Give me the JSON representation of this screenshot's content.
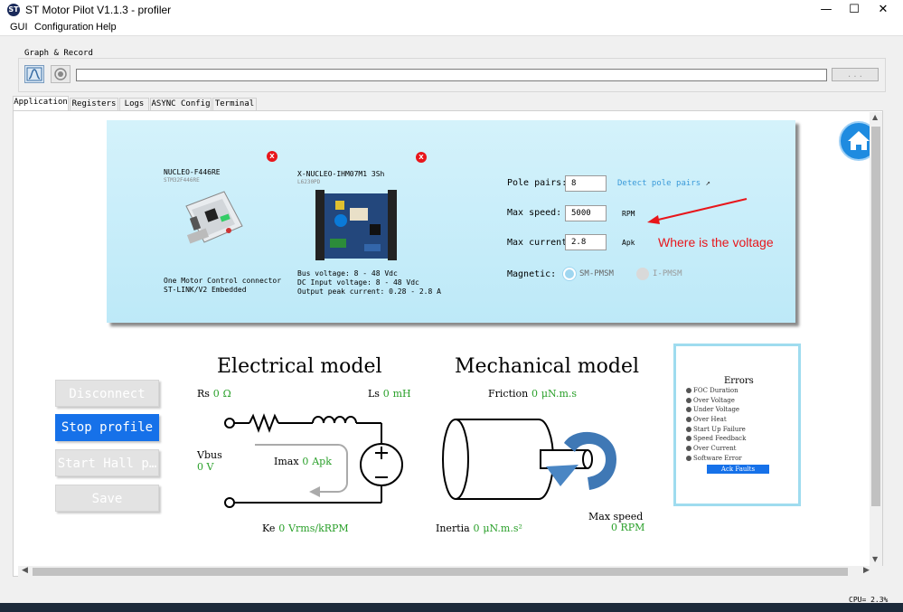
{
  "window": {
    "title": "ST Motor Pilot V1.1.3 - profiler",
    "minimize": "—",
    "maximize": "☐",
    "close": "✕"
  },
  "menu": [
    "GUI",
    "Configuration",
    "Help"
  ],
  "graph_record": {
    "label": "Graph & Record",
    "path_value": "",
    "browse_label": ". . ."
  },
  "tabs": [
    "Application",
    "Registers",
    "Logs",
    "ASYNC Config",
    "Terminal"
  ],
  "boards": {
    "control": {
      "name": "NUCLEO-F446RE",
      "sub": "STM32F446RE",
      "desc": "One Motor Control connector\nST-LINK/V2 Embedded"
    },
    "power": {
      "name": "X-NUCLEO-IHM07M1 3Sh",
      "sub": "L6230PD",
      "desc": "Bus voltage: 8 - 48 Vdc\nDC Input voltage: 8 - 48 Vdc\nOutput peak current: 0.28 - 2.8 A"
    },
    "remove_label": "X"
  },
  "motor": {
    "pole_pairs_label": "Pole pairs:",
    "pole_pairs_value": "8",
    "detect_link": "Detect pole pairs",
    "max_speed_label": "Max speed:",
    "max_speed_value": "5000",
    "max_speed_unit": "RPM",
    "max_current_label": "Max current:",
    "max_current_value": "2.8",
    "max_current_unit": "Apk",
    "magnetic_label": "Magnetic:",
    "magnetic_options": [
      "SM-PMSM",
      "I-PMSM"
    ],
    "magnetic_selected": "SM-PMSM"
  },
  "annotation": "Where is the voltage",
  "buttons": {
    "disconnect": "Disconnect",
    "stop_profile": "Stop profile",
    "start_hall": "Start Hall p…",
    "save": "Save"
  },
  "electrical": {
    "title": "Electrical model",
    "rs_label": "Rs",
    "rs_value": "0",
    "rs_unit": "Ω",
    "ls_label": "Ls",
    "ls_value": "0",
    "ls_unit": "mH",
    "vbus_label": "Vbus",
    "vbus_value": "0 V",
    "imax_label": "Imax",
    "imax_value": "0",
    "imax_unit": "Apk",
    "ke_label": "Ke",
    "ke_value": "0",
    "ke_unit": "Vrms/kRPM"
  },
  "mechanical": {
    "title": "Mechanical model",
    "friction_label": "Friction",
    "friction_value": "0",
    "friction_unit": "μN.m.s",
    "inertia_label": "Inertia",
    "inertia_value": "0",
    "inertia_unit": "μN.m.s²",
    "max_speed_label": "Max speed",
    "max_speed_value": "0 RPM"
  },
  "errors": {
    "title": "Errors",
    "items": [
      "FOC Duration",
      "Over Voltage",
      "Under Voltage",
      "Over Heat",
      "Start Up Failure",
      "Speed Feedback",
      "Over Current",
      "Software Error"
    ],
    "ack_label": "Ack Faults"
  },
  "status": {
    "cpu": "CPU= 2.3%"
  },
  "colors": {
    "accent": "#1671e9",
    "value_green": "#2aa02a",
    "annotation_red": "#e8161b",
    "link_blue": "#3a9ad9"
  }
}
